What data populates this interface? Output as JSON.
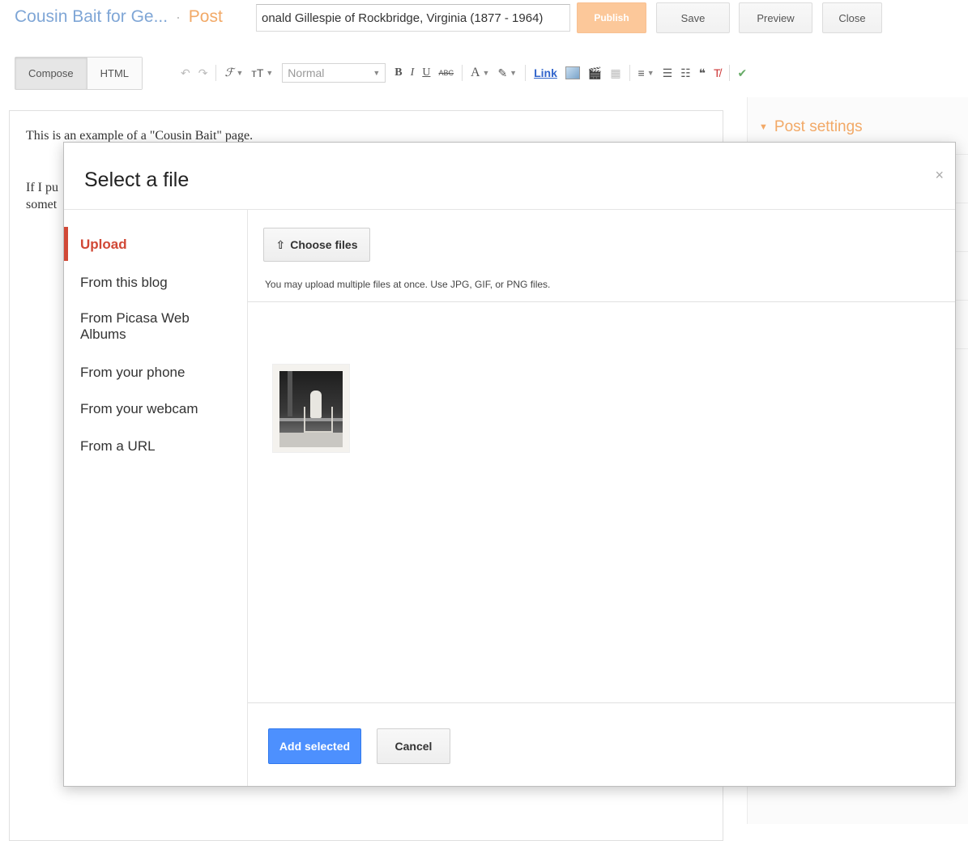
{
  "header": {
    "blog_title": "Cousin Bait for Ge...",
    "separator": "·",
    "section": "Post",
    "post_title_value": "onald Gillespie of Rockbridge, Virginia (1877 - 1964)",
    "publish_label": "Publish",
    "save_label": "Save",
    "preview_label": "Preview",
    "close_label": "Close"
  },
  "toolbar": {
    "compose_label": "Compose",
    "html_label": "HTML",
    "font_glyph": "ℱ",
    "size_glyph": "тT",
    "format_value": "Normal",
    "bold": "B",
    "italic": "I",
    "underline": "U",
    "strike": "ABC",
    "text_color": "A",
    "link_label": "Link"
  },
  "editor": {
    "line1": "This is an example of a \"Cousin Bait\" page.",
    "line2": "If I pu",
    "line3": "somet"
  },
  "sidebar": {
    "post_settings_label": "Post settings"
  },
  "dialog": {
    "title": "Select a file",
    "close_glyph": "×",
    "nav": [
      {
        "label": "Upload",
        "active": true
      },
      {
        "label": "From this blog",
        "active": false
      },
      {
        "label": "From Picasa Web Albums",
        "active": false
      },
      {
        "label": "From your phone",
        "active": false
      },
      {
        "label": "From your webcam",
        "active": false
      },
      {
        "label": "From a URL",
        "active": false
      }
    ],
    "choose_files_label": "Choose files",
    "hint": "You may upload multiple files at once. Use JPG, GIF, or PNG files.",
    "add_selected_label": "Add selected",
    "cancel_label": "Cancel"
  },
  "colors": {
    "accent_orange": "#f2a967",
    "active_red": "#d14836",
    "primary_blue": "#4d90fe",
    "title_blue": "#7fa6d6"
  }
}
